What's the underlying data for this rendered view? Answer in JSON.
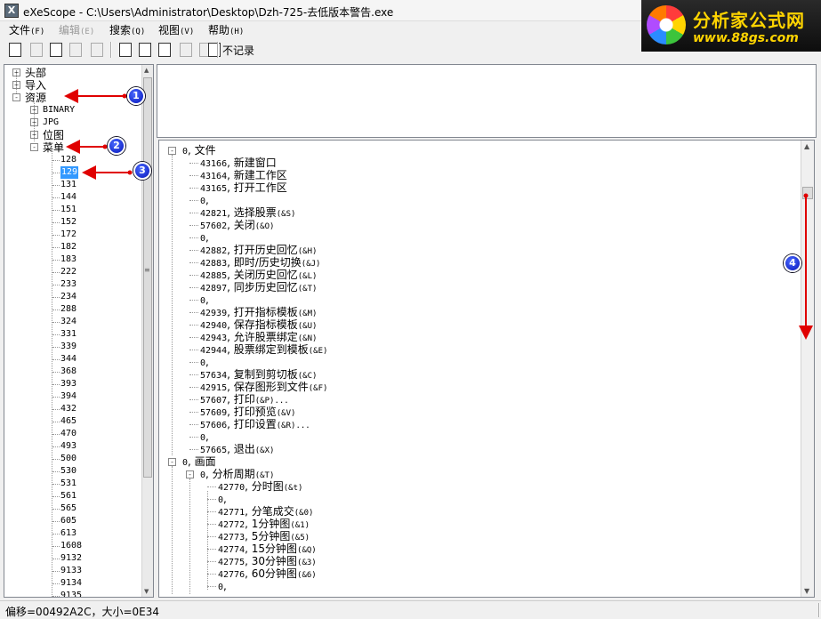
{
  "window": {
    "title": "eXeScope - C:\\Users\\Administrator\\Desktop\\Dzh-725-去低版本警告.exe",
    "app_icon": "exescope-app-icon",
    "logo_text": "分析家公式网",
    "logo_url": "www.88gs.com"
  },
  "menu": [
    {
      "label": "文件",
      "acc": "(F)",
      "enabled": true
    },
    {
      "label": "编辑",
      "acc": "(E)",
      "enabled": false
    },
    {
      "label": "搜索",
      "acc": "(Q)",
      "enabled": true
    },
    {
      "label": "视图",
      "acc": "(V)",
      "enabled": true
    },
    {
      "label": "帮助",
      "acc": "(H)",
      "enabled": true
    }
  ],
  "toolbar": {
    "buttons": [
      {
        "icon": "open-file-icon",
        "enabled": true
      },
      {
        "icon": "save-icon",
        "enabled": false
      },
      {
        "icon": "save-as-icon",
        "enabled": true
      },
      {
        "icon": "copy-icon",
        "enabled": false
      },
      {
        "icon": "xp-icon",
        "enabled": false
      },
      {
        "icon": "font-icon",
        "enabled": true
      },
      {
        "icon": "export-icon",
        "enabled": true
      },
      {
        "icon": "page-icon",
        "enabled": true
      },
      {
        "icon": "image-icon",
        "enabled": false
      },
      {
        "icon": "dialog-icon",
        "enabled": false
      },
      {
        "icon": "no-record-icon",
        "enabled": true
      }
    ],
    "no_record_label": "不记录"
  },
  "left_tree": {
    "nodes": [
      {
        "label": "头部",
        "expander": "+"
      },
      {
        "label": "导入",
        "expander": "+"
      },
      {
        "label": "资源",
        "expander": "-"
      },
      {
        "label": "BINARY",
        "expander": "+"
      },
      {
        "label": "JPG",
        "expander": "+"
      },
      {
        "label": "位图",
        "expander": "+"
      },
      {
        "label": "菜单",
        "expander": "-"
      }
    ],
    "menu_items": [
      "128",
      "129",
      "131",
      "144",
      "151",
      "152",
      "172",
      "182",
      "183",
      "222",
      "233",
      "234",
      "288",
      "324",
      "331",
      "339",
      "344",
      "368",
      "393",
      "394",
      "432",
      "465",
      "470",
      "493",
      "500",
      "530",
      "531",
      "561",
      "565",
      "605",
      "613",
      "1608",
      "9132",
      "9133",
      "9134",
      "9135"
    ],
    "selected_item": "129"
  },
  "right_tree": {
    "rows": [
      {
        "level": 0,
        "expander": "-",
        "num": "0",
        "text": "文件",
        "acc": ""
      },
      {
        "level": 1,
        "expander": "",
        "num": "43166",
        "text": "新建窗口",
        "acc": ""
      },
      {
        "level": 1,
        "expander": "",
        "num": "43164",
        "text": "新建工作区",
        "acc": ""
      },
      {
        "level": 1,
        "expander": "",
        "num": "43165",
        "text": "打开工作区",
        "acc": ""
      },
      {
        "level": 1,
        "expander": "",
        "num": "0",
        "text": "",
        "acc": ""
      },
      {
        "level": 1,
        "expander": "",
        "num": "42821",
        "text": "选择股票",
        "acc": "(&S)"
      },
      {
        "level": 1,
        "expander": "",
        "num": "57602",
        "text": "关闭",
        "acc": "(&O)"
      },
      {
        "level": 1,
        "expander": "",
        "num": "0",
        "text": "",
        "acc": ""
      },
      {
        "level": 1,
        "expander": "",
        "num": "42882",
        "text": "打开历史回忆",
        "acc": "(&H)"
      },
      {
        "level": 1,
        "expander": "",
        "num": "42883",
        "text": "即时/历史切换",
        "acc": "(&J)"
      },
      {
        "level": 1,
        "expander": "",
        "num": "42885",
        "text": "关闭历史回忆",
        "acc": "(&L)"
      },
      {
        "level": 1,
        "expander": "",
        "num": "42897",
        "text": "同步历史回忆",
        "acc": "(&T)"
      },
      {
        "level": 1,
        "expander": "",
        "num": "0",
        "text": "",
        "acc": ""
      },
      {
        "level": 1,
        "expander": "",
        "num": "42939",
        "text": "打开指标模板",
        "acc": "(&M)"
      },
      {
        "level": 1,
        "expander": "",
        "num": "42940",
        "text": "保存指标模板",
        "acc": "(&U)"
      },
      {
        "level": 1,
        "expander": "",
        "num": "42943",
        "text": "允许股票绑定",
        "acc": "(&N)"
      },
      {
        "level": 1,
        "expander": "",
        "num": "42944",
        "text": "股票绑定到模板",
        "acc": "(&E)"
      },
      {
        "level": 1,
        "expander": "",
        "num": "0",
        "text": "",
        "acc": ""
      },
      {
        "level": 1,
        "expander": "",
        "num": "57634",
        "text": "复制到剪切板",
        "acc": "(&C)"
      },
      {
        "level": 1,
        "expander": "",
        "num": "42915",
        "text": "保存图形到文件",
        "acc": "(&F)"
      },
      {
        "level": 1,
        "expander": "",
        "num": "57607",
        "text": "打印",
        "acc": "(&P)..."
      },
      {
        "level": 1,
        "expander": "",
        "num": "57609",
        "text": "打印预览",
        "acc": "(&V)"
      },
      {
        "level": 1,
        "expander": "",
        "num": "57606",
        "text": "打印设置",
        "acc": "(&R)..."
      },
      {
        "level": 1,
        "expander": "",
        "num": "0",
        "text": "",
        "acc": ""
      },
      {
        "level": 1,
        "expander": "",
        "num": "57665",
        "text": "退出",
        "acc": "(&X)"
      },
      {
        "level": 0,
        "expander": "-",
        "num": "0",
        "text": "画面",
        "acc": ""
      },
      {
        "level": 1,
        "expander": "-",
        "num": "0",
        "text": "分析周期",
        "acc": "(&T)"
      },
      {
        "level": 2,
        "expander": "",
        "num": "42770",
        "text": "分时图",
        "acc": "(&t)"
      },
      {
        "level": 2,
        "expander": "",
        "num": "0",
        "text": "",
        "acc": ""
      },
      {
        "level": 2,
        "expander": "",
        "num": "42771",
        "text": "分笔成交",
        "acc": "(&0)"
      },
      {
        "level": 2,
        "expander": "",
        "num": "42772",
        "text": "1分钟图",
        "acc": "(&1)"
      },
      {
        "level": 2,
        "expander": "",
        "num": "42773",
        "text": "5分钟图",
        "acc": "(&5)"
      },
      {
        "level": 2,
        "expander": "",
        "num": "42774",
        "text": "15分钟图",
        "acc": "(&Q)"
      },
      {
        "level": 2,
        "expander": "",
        "num": "42775",
        "text": "30分钟图",
        "acc": "(&3)"
      },
      {
        "level": 2,
        "expander": "",
        "num": "42776",
        "text": "60分钟图",
        "acc": "(&6)"
      },
      {
        "level": 2,
        "expander": "",
        "num": "0",
        "text": "",
        "acc": ""
      }
    ]
  },
  "status": {
    "text": "偏移=00492A2C，大小=0E34"
  },
  "annotations": {
    "badges": [
      "1",
      "2",
      "3",
      "4"
    ],
    "arrow_color": "#e00000",
    "badge_color": "#1a2ecf"
  }
}
